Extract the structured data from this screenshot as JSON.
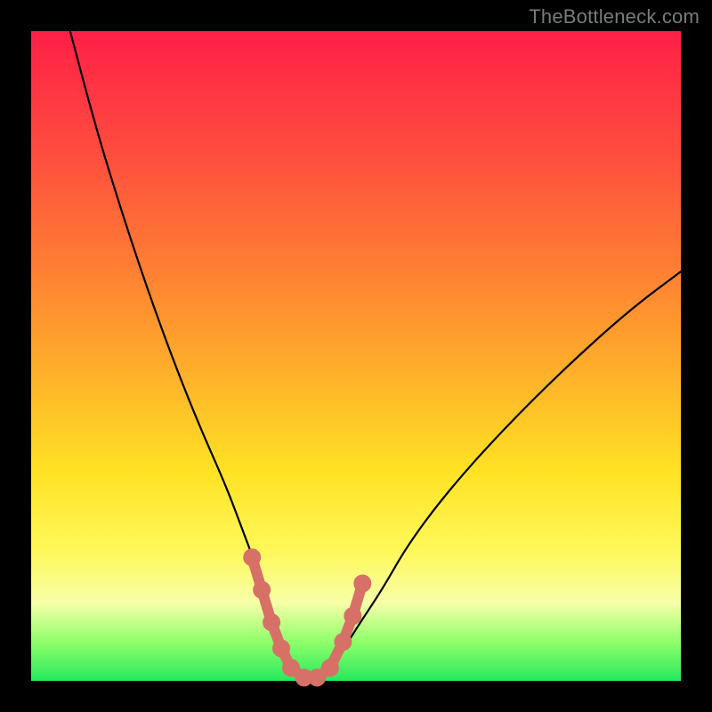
{
  "watermark": "TheBottleneck.com",
  "chart_data": {
    "type": "line",
    "title": "",
    "xlabel": "",
    "ylabel": "",
    "xlim": [
      0,
      100
    ],
    "ylim": [
      0,
      100
    ],
    "grid": false,
    "legend": false,
    "background_gradient": [
      "#ff1f47",
      "#ff7a34",
      "#ffe324",
      "#f7ffa8",
      "#26e95d"
    ],
    "series": [
      {
        "name": "bottleneck-curve",
        "color": "#000000",
        "x": [
          6,
          10,
          14,
          18,
          22,
          26,
          30,
          33,
          36,
          38,
          40,
          42,
          44,
          47,
          50,
          54,
          58,
          64,
          72,
          82,
          92,
          100
        ],
        "y": [
          100,
          85,
          72,
          60,
          49,
          39,
          30,
          22,
          14,
          8,
          3,
          0,
          0,
          3,
          8,
          14,
          21,
          29,
          38,
          48,
          57,
          63
        ]
      }
    ],
    "markers": {
      "name": "highlight-region",
      "color": "#d77066",
      "points": [
        {
          "x": 34.0,
          "y": 19
        },
        {
          "x": 35.5,
          "y": 14
        },
        {
          "x": 37.0,
          "y": 9
        },
        {
          "x": 38.5,
          "y": 5
        },
        {
          "x": 40.0,
          "y": 2
        },
        {
          "x": 42.0,
          "y": 0.5
        },
        {
          "x": 44.0,
          "y": 0.5
        },
        {
          "x": 46.0,
          "y": 2
        },
        {
          "x": 48.0,
          "y": 6
        },
        {
          "x": 49.5,
          "y": 10
        },
        {
          "x": 51.0,
          "y": 15
        }
      ]
    }
  }
}
